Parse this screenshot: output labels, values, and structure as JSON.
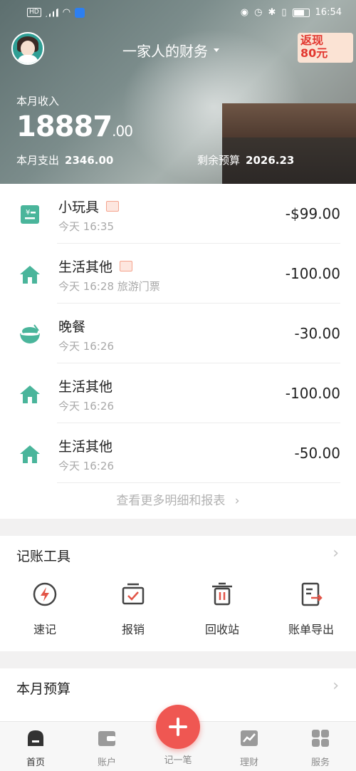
{
  "status_bar": {
    "network_label": "HD",
    "time": "16:54"
  },
  "header": {
    "book_title": "一家人的财务",
    "promo_line1": "返现",
    "promo_line2": "80元",
    "income_label": "本月收入",
    "income_value": "18887",
    "income_decimal": ".00",
    "expense_label": "本月支出",
    "expense_value": "2346.00",
    "budget_left_label": "剩余预算",
    "budget_left_value": "2026.23"
  },
  "transactions": [
    {
      "title": "小玩具",
      "has_image": true,
      "meta": "今天 16:35",
      "amount": "-$99.00",
      "icon": "cash-note-icon"
    },
    {
      "title": "生活其他",
      "has_image": true,
      "meta": "今天 16:28  旅游门票",
      "amount": "-100.00",
      "icon": "house-icon"
    },
    {
      "title": "晚餐",
      "has_image": false,
      "meta": "今天 16:26",
      "amount": "-30.00",
      "icon": "rice-bowl-icon"
    },
    {
      "title": "生活其他",
      "has_image": false,
      "meta": "今天 16:26",
      "amount": "-100.00",
      "icon": "house-icon"
    },
    {
      "title": "生活其他",
      "has_image": false,
      "meta": "今天 16:26",
      "amount": "-50.00",
      "icon": "house-icon"
    }
  ],
  "more_link": "查看更多明细和报表",
  "tools": {
    "title": "记账工具",
    "items": [
      {
        "label": "速记",
        "icon": "lightning-icon"
      },
      {
        "label": "报销",
        "icon": "reimburse-icon"
      },
      {
        "label": "回收站",
        "icon": "trash-icon"
      },
      {
        "label": "账单导出",
        "icon": "export-icon"
      }
    ]
  },
  "budget_section": {
    "title": "本月预算"
  },
  "tabbar": {
    "items": [
      {
        "label": "首页",
        "icon": "home-icon"
      },
      {
        "label": "账户",
        "icon": "wallet-icon"
      },
      {
        "label": "记一笔",
        "icon": "plus-icon"
      },
      {
        "label": "理财",
        "icon": "chart-icon"
      },
      {
        "label": "服务",
        "icon": "grid-icon"
      }
    ]
  },
  "colors": {
    "accent": "#ef5752",
    "category_green": "#4ab59b",
    "tool_red": "#e25548"
  }
}
